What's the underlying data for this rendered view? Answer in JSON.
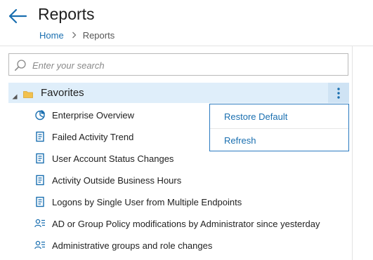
{
  "header": {
    "title": "Reports",
    "breadcrumb": [
      {
        "label": "Home"
      },
      {
        "label": "Reports"
      }
    ],
    "breadcrumb_separator": ">"
  },
  "search": {
    "placeholder": "Enter your search",
    "value": ""
  },
  "favorites": {
    "label": "Favorites",
    "expanded": true,
    "more_icon": "vertical-ellipsis-icon",
    "items": [
      {
        "label": "Enterprise Overview",
        "icon": "pie-chart-icon"
      },
      {
        "label": "Failed Activity Trend",
        "icon": "document-icon"
      },
      {
        "label": "User Account Status Changes",
        "icon": "document-icon"
      },
      {
        "label": "Activity Outside Business Hours",
        "icon": "document-icon"
      },
      {
        "label": "Logons by Single User from Multiple Endpoints",
        "icon": "document-icon"
      },
      {
        "label": "AD or Group Policy modifications by Administrator since yesterday",
        "icon": "user-list-icon"
      },
      {
        "label": "Administrative groups and role changes",
        "icon": "user-list-icon"
      }
    ]
  },
  "context_menu": {
    "items": [
      {
        "label": "Restore Default"
      },
      {
        "label": "Refresh"
      }
    ]
  },
  "colors": {
    "accent": "#1a6fb0",
    "selected_row": "#dfeefa",
    "menu_border": "#2a7ac0",
    "folder": "#f2c14e"
  }
}
